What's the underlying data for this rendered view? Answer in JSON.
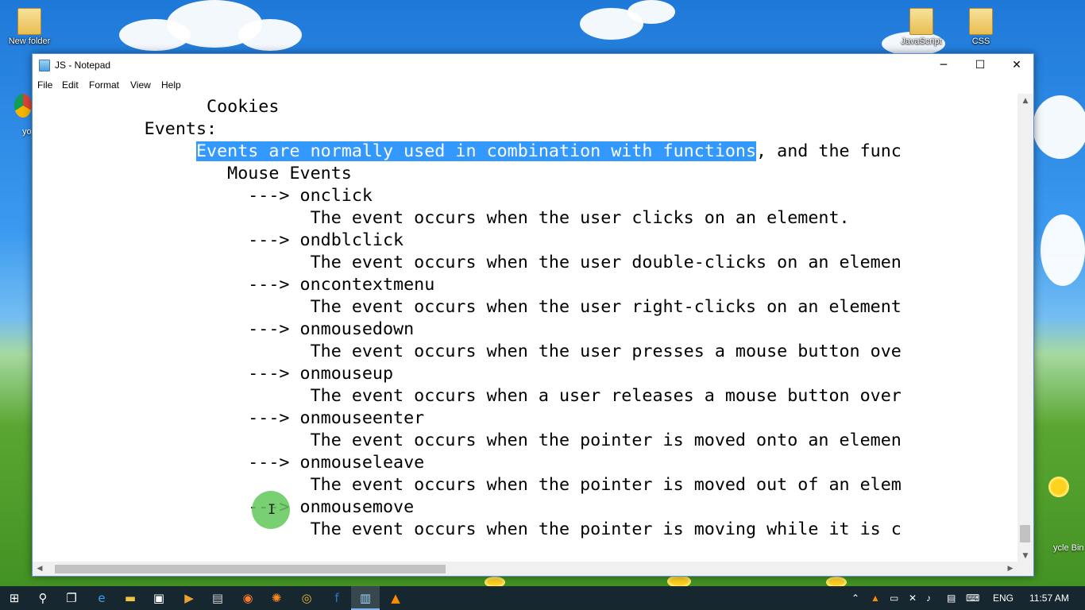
{
  "desktop": {
    "icons": [
      {
        "label": "New folder"
      },
      {
        "label": "JavaScript"
      },
      {
        "label": "CSS"
      }
    ],
    "partial_labels": {
      "left": "yo",
      "right": "ycle Bin"
    }
  },
  "window": {
    "title": "JS - Notepad",
    "controls": {
      "minimize": "─",
      "maximize": "☐",
      "close": "✕"
    },
    "menu": [
      "File",
      "Edit",
      "Format",
      "View",
      "Help"
    ],
    "lines": [
      "                  Cookies",
      "            Events:",
      "                 Events are normally used in combination with functions, and the func",
      "                    Mouse Events",
      "                      ---> onclick",
      "                            The event occurs when the user clicks on an element.",
      "                      ---> ondblclick",
      "                            The event occurs when the user double-clicks on an elemen",
      "                      ---> oncontextmenu",
      "                            The event occurs when the user right-clicks on an element",
      "                      ---> onmousedown",
      "                            The event occurs when the user presses a mouse button ove",
      "                      ---> onmouseup",
      "                            The event occurs when a user releases a mouse button over",
      "                      ---> onmouseenter",
      "                            The event occurs when the pointer is moved onto an elemen",
      "                      ---> onmouseleave",
      "                            The event occurs when the pointer is moved out of an elem",
      "                      ---> onmousemove",
      "                            The event occurs when the pointer is moving while it is c"
    ],
    "selection": {
      "line_index": 2,
      "selected_text": "Events are normally used in combination with functions",
      "rest_text": ", and the func",
      "prefix": "                 "
    },
    "selection_color": "#3399ff"
  },
  "taskbar": {
    "buttons": [
      {
        "icon": "windows-start-icon"
      },
      {
        "icon": "search-icon"
      },
      {
        "icon": "task-view-icon"
      },
      {
        "icon": "edge-browser-icon"
      },
      {
        "icon": "file-explorer-icon"
      },
      {
        "icon": "store-icon"
      },
      {
        "icon": "media-player-icon"
      },
      {
        "icon": "film-icon"
      },
      {
        "icon": "firefox-icon"
      },
      {
        "icon": "paint-splash-icon"
      },
      {
        "icon": "chrome-icon"
      },
      {
        "icon": "facebook-icon"
      },
      {
        "icon": "notepad-icon"
      },
      {
        "icon": "vlc-icon"
      }
    ],
    "tray": {
      "language": "ENG",
      "time": "11:57 AM"
    }
  }
}
